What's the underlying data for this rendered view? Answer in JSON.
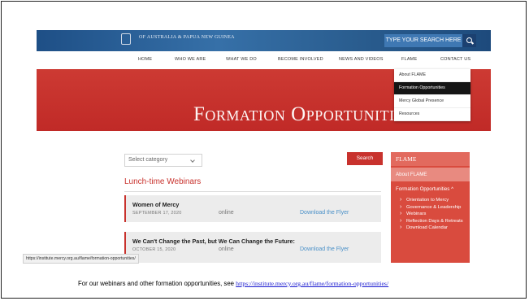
{
  "site": {
    "org_name": "OF AUSTRALIA & PAPUA NEW GUINEA",
    "search_placeholder": "TYPE YOUR SEARCH HERE",
    "brand_color": "#c8322d",
    "topbar_color": "#2a5d8f"
  },
  "nav": {
    "items": [
      "HOME",
      "WHO WE ARE",
      "WHAT WE DO",
      "BECOME INVOLVED",
      "NEWS AND VIDEOS",
      "FLAME",
      "CONTACT US"
    ]
  },
  "dropdown": {
    "items": [
      "About FLAME",
      "Formation Opportunities",
      "Mercy Global Presence",
      "Resources"
    ],
    "active": "Formation Opportunities"
  },
  "hero": {
    "title": "Formation Opportunities"
  },
  "filter": {
    "select_value": "Select category",
    "search_button": "Search"
  },
  "section": {
    "title": "Lunch-time Webinars"
  },
  "events": [
    {
      "title": "Women of Mercy",
      "date": "SEPTEMBER 17, 2020",
      "mode": "online",
      "link": "Download the Flyer"
    },
    {
      "title": "We Can't Change the Past, but We Can Change the Future:",
      "date": "OCTOBER 15, 2020",
      "mode": "online",
      "link": "Download the Flyer"
    }
  ],
  "sidebar": {
    "heading": "FLAME",
    "about": "About FLAME",
    "sub_heading": "Formation Opportunities ^",
    "items": [
      "Orientation to Mercy",
      "Governance & Leadership",
      "Webinars",
      "Reflection Days & Retreats",
      "Download Calendar"
    ]
  },
  "status_bar": {
    "url": "https://institute.mercy.org.au/flame/formation-opportunities/"
  },
  "caption": {
    "text": "For our webinars and other formation opportunities, see",
    "link": "https://institute.mercy.org.au/flame/formation-opportunities/"
  }
}
